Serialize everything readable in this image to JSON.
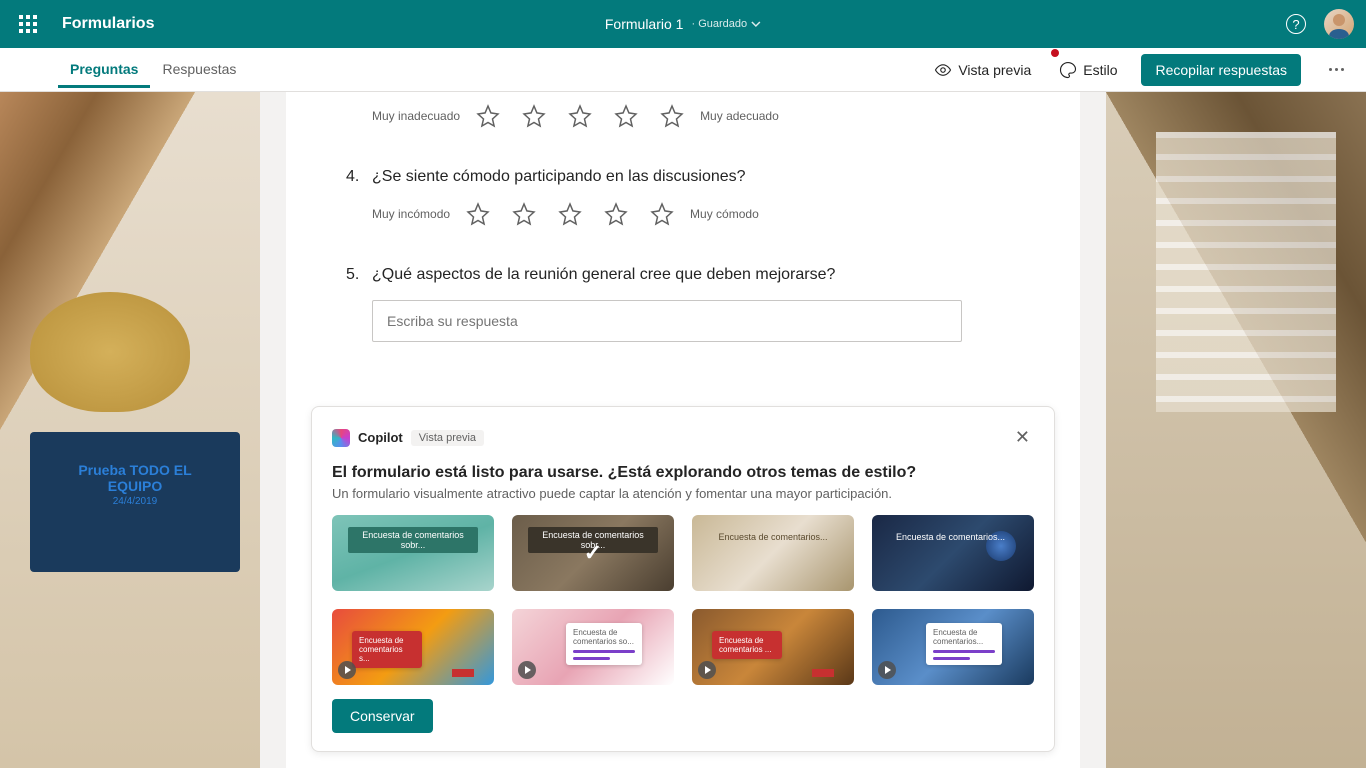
{
  "topbar": {
    "app_name": "Formularios",
    "form_title": "Formulario 1",
    "saved": "· Guardado"
  },
  "subbar": {
    "tab_questions": "Preguntas",
    "tab_responses": "Respuestas",
    "preview": "Vista previa",
    "style": "Estilo",
    "collect": "Recopilar respuestas"
  },
  "bg": {
    "monitor_title": "Prueba TODO EL EQUIPO",
    "monitor_date": "24/4/2019"
  },
  "questions": {
    "q3": {
      "left_label": "Muy inadecuado",
      "right_label": "Muy adecuado"
    },
    "q4": {
      "num": "4.",
      "text": "¿Se siente cómodo participando en las discusiones?",
      "left_label": "Muy incómodo",
      "right_label": "Muy cómodo"
    },
    "q5": {
      "num": "5.",
      "text": "¿Qué aspectos de la reunión general cree que deben mejorarse?",
      "placeholder": "Escriba su respuesta"
    }
  },
  "copilot": {
    "name": "Copilot",
    "tag": "Vista previa",
    "title": "El formulario está listo para usarse. ¿Está explorando otros temas de estilo?",
    "subtitle": "Un formulario visualmente atractivo puede captar la atención y fomentar una mayor participación.",
    "keep": "Conservar",
    "themes": {
      "t1": "Encuesta de comentarios sobr...",
      "t2": "Encuesta de comentarios sobr...",
      "t3": "Encuesta de comentarios...",
      "t4": "Encuesta de comentarios...",
      "t5": "Encuesta de comentarios s...",
      "t6": "Encuesta de comentarios so...",
      "t7": "Encuesta de comentarios ...",
      "t8": "Encuesta de comentarios..."
    }
  }
}
